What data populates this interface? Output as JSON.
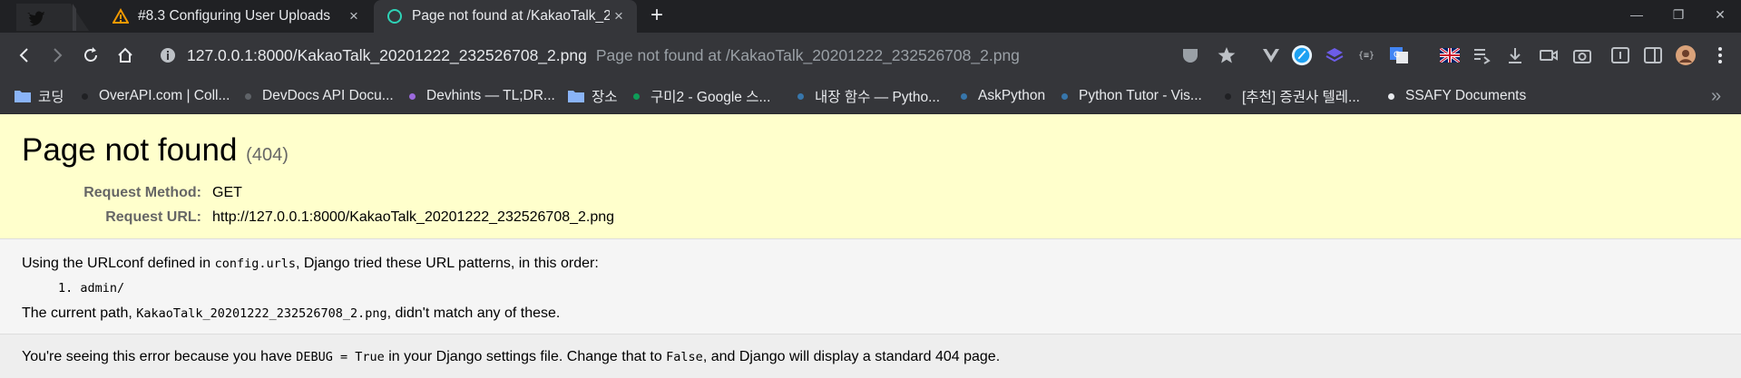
{
  "browser": {
    "tabs": [
      {
        "title": "#8.3 Configuring User Uploads",
        "favicon": "warning-triangle-icon",
        "close": "×"
      },
      {
        "title": "Page not found at /KakaoTalk_2",
        "favicon": "circle-outline-icon",
        "close": "×"
      }
    ],
    "new_tab": "+",
    "window_controls": {
      "minimize": "—",
      "restore": "❐",
      "close": "✕"
    },
    "url": "127.0.0.1:8000/KakaoTalk_20201222_232526708_2.png",
    "page_title_ghost": "Page not found at /KakaoTalk_20201222_232526708_2.png",
    "bookmarks": [
      {
        "label": "코딩",
        "type": "folder"
      },
      {
        "label": "OverAPI.com | Coll...",
        "type": "link",
        "color": "#202124"
      },
      {
        "label": "DevDocs API Docu...",
        "type": "link",
        "color": "#5f6368"
      },
      {
        "label": "Devhints — TL;DR...",
        "type": "link",
        "color": "#9c6ade"
      },
      {
        "label": "장소",
        "type": "folder"
      },
      {
        "label": "구미2 - Google 스...",
        "type": "link",
        "color": "#0f9d58"
      },
      {
        "label": "내장 함수 — Pytho...",
        "type": "link",
        "color": "#3776ab"
      },
      {
        "label": "AskPython",
        "type": "link",
        "color": "#3776ab"
      },
      {
        "label": "Python Tutor - Vis...",
        "type": "link",
        "color": "#3776ab"
      },
      {
        "label": "[추천] 증권사 텔레...",
        "type": "link",
        "color": "#202124"
      },
      {
        "label": "SSAFY Documents",
        "type": "link",
        "color": "#e8eaed"
      }
    ],
    "more_bookmarks": "»"
  },
  "page": {
    "title": "Page not found",
    "status_code": "(404)",
    "request_method_label": "Request Method:",
    "request_method": "GET",
    "request_url_label": "Request URL:",
    "request_url": "http://127.0.0.1:8000/KakaoTalk_20201222_232526708_2.png",
    "urlconf_prefix": "Using the URLconf defined in ",
    "urlconf_module": "config.urls",
    "urlconf_suffix": ", Django tried these URL patterns, in this order:",
    "patterns": [
      "1. admin/"
    ],
    "current_path_prefix": "The current path, ",
    "current_path": "KakaoTalk_20201222_232526708_2.png",
    "current_path_suffix": ", didn't match any of these.",
    "explanation_prefix": "You're seeing this error because you have ",
    "debug_setting": "DEBUG = True",
    "explanation_middle": " in your Django settings file. Change that to ",
    "false_value": "False",
    "explanation_suffix": ", and Django will display a standard 404 page."
  },
  "colors": {
    "summary_bg": "#ffffcc",
    "info_bg": "#f5f5f5",
    "explanation_bg": "#eeeeee",
    "chrome_dark": "#202124",
    "chrome_toolbar": "#35363a"
  }
}
